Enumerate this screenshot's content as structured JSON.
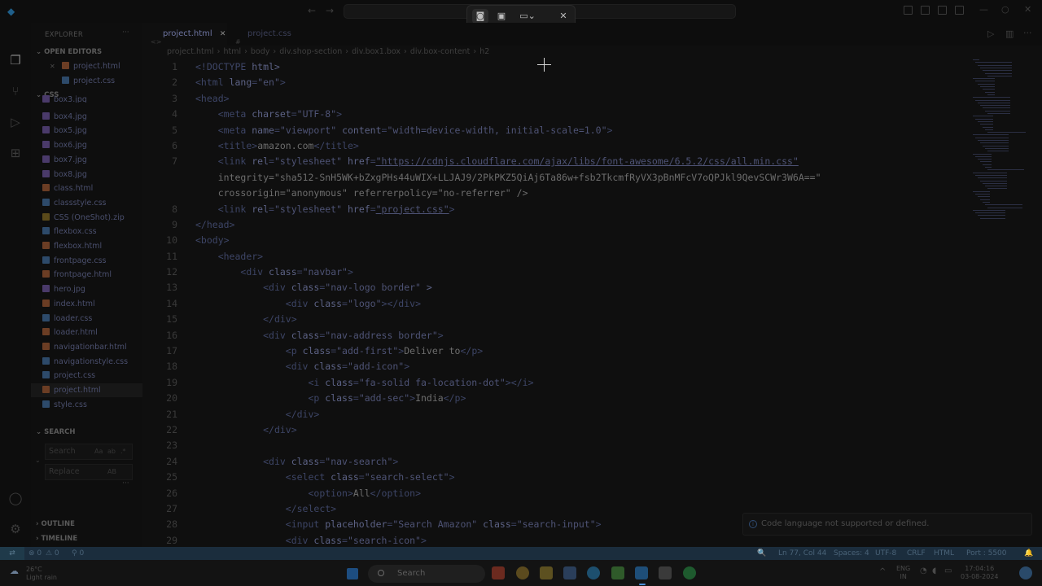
{
  "snip_toolbar": {
    "items": [
      "camera-icon",
      "video-icon",
      "rect-mode-icon",
      "close-icon"
    ],
    "mode_chevron": "⌄",
    "close_label": "✕"
  },
  "titlebar": {
    "back": "←",
    "forward": "→"
  },
  "explorer": {
    "title": "EXPLORER",
    "more": "···",
    "open_editors_label": "OPEN EDITORS",
    "open_editors": [
      {
        "name": "project.html",
        "type": "html"
      },
      {
        "name": "project.css",
        "type": "css"
      }
    ],
    "folder_label": "CSS",
    "files": [
      {
        "name": "box3.jpg",
        "type": "jpg"
      },
      {
        "name": "box4.jpg",
        "type": "jpg"
      },
      {
        "name": "box5.jpg",
        "type": "jpg"
      },
      {
        "name": "box6.jpg",
        "type": "jpg"
      },
      {
        "name": "box7.jpg",
        "type": "jpg"
      },
      {
        "name": "box8.jpg",
        "type": "jpg"
      },
      {
        "name": "class.html",
        "type": "html"
      },
      {
        "name": "classstyle.css",
        "type": "css"
      },
      {
        "name": "CSS (OneShot).zip",
        "type": "zip"
      },
      {
        "name": "flexbox.css",
        "type": "css"
      },
      {
        "name": "flexbox.html",
        "type": "html"
      },
      {
        "name": "frontpage.css",
        "type": "css"
      },
      {
        "name": "frontpage.html",
        "type": "html"
      },
      {
        "name": "hero.jpg",
        "type": "jpg"
      },
      {
        "name": "index.html",
        "type": "html"
      },
      {
        "name": "loader.css",
        "type": "css"
      },
      {
        "name": "loader.html",
        "type": "html"
      },
      {
        "name": "navigationbar.html",
        "type": "html"
      },
      {
        "name": "navigationstyle.css",
        "type": "css"
      },
      {
        "name": "project.css",
        "type": "css"
      },
      {
        "name": "project.html",
        "type": "html",
        "selected": true
      },
      {
        "name": "style.css",
        "type": "css"
      }
    ],
    "search_label": "SEARCH",
    "search_placeholder": "Search",
    "search_case": "Aa",
    "search_word": "ab",
    "search_regex": ".*",
    "replace_placeholder": "Replace",
    "replace_all": "AB",
    "outline_label": "OUTLINE",
    "timeline_label": "TIMELINE"
  },
  "tabs": [
    {
      "label": "project.html",
      "active": true,
      "close": "✕"
    },
    {
      "label": "project.css",
      "active": false
    }
  ],
  "breadcrumbs": [
    "project.html",
    "html",
    "body",
    "div.shop-section",
    "div.box1.box",
    "div.box-content",
    "h2"
  ],
  "line_numbers": [
    "1",
    "2",
    "3",
    "4",
    "5",
    "6",
    "7",
    "",
    "",
    "8",
    "9",
    "10",
    "11",
    "12",
    "13",
    "14",
    "15",
    "16",
    "17",
    "18",
    "19",
    "20",
    "21",
    "22",
    "23",
    "24",
    "25",
    "26",
    "27",
    "28",
    "29"
  ],
  "code_lines": [
    "<!DOCTYPE html>",
    "<html lang=\"en\">",
    "<head>",
    "    <meta charset=\"UTF-8\">",
    "    <meta name=\"viewport\" content=\"width=device-width, initial-scale=1.0\">",
    "    <title>amazon.com</title>",
    "    <link rel=\"stylesheet\" href=\"https://cdnjs.cloudflare.com/ajax/libs/font-awesome/6.5.2/css/all.min.css\"",
    "    integrity=\"sha512-SnH5WK+bZxgPHs44uWIX+LLJAJ9/2PkPKZ5QiAj6Ta86w+fsb2TkcmfRyVX3pBnMFcV7oQPJkl9QevSCWr3W6A==\"",
    "    crossorigin=\"anonymous\" referrerpolicy=\"no-referrer\" />",
    "    <link rel=\"stylesheet\" href=\"project.css\">",
    "</head>",
    "<body>",
    "    <header>",
    "        <div class=\"navbar\">",
    "            <div class=\"nav-logo border\" >",
    "                <div class=\"logo\"></div>",
    "            </div>",
    "            <div class=\"nav-address border\">",
    "                <p class=\"add-first\">Deliver to</p>",
    "                <div class=\"add-icon\">",
    "                    <i class=\"fa-solid fa-location-dot\"></i>",
    "                    <p class=\"add-sec\">India</p>",
    "                </div>",
    "            </div>",
    "",
    "            <div class=\"nav-search\">",
    "                <select class=\"search-select\">",
    "                    <option>All</option>",
    "                </select>",
    "                <input placeholder=\"Search Amazon\" class=\"search-input\">",
    "                <div class=\"search-icon\">"
  ],
  "notification": "Code language not supported or defined.",
  "status": {
    "remote": "⇄",
    "errors": "⊗ 0",
    "warnings": "⚠ 0",
    "ports": "⚲ 0",
    "zoom": "🔍",
    "position": "Ln 77, Col 44",
    "spaces": "Spaces: 4",
    "encoding": "UTF-8",
    "eol": "CRLF",
    "language": "HTML",
    "port": "Port : 5500"
  },
  "taskbar": {
    "temp": "26°C",
    "weather": "Light rain",
    "search": "Search",
    "lang1": "ENG",
    "lang2": "IN",
    "time": "17:04:16",
    "date": "03-08-2024",
    "chevron_up": "^"
  }
}
